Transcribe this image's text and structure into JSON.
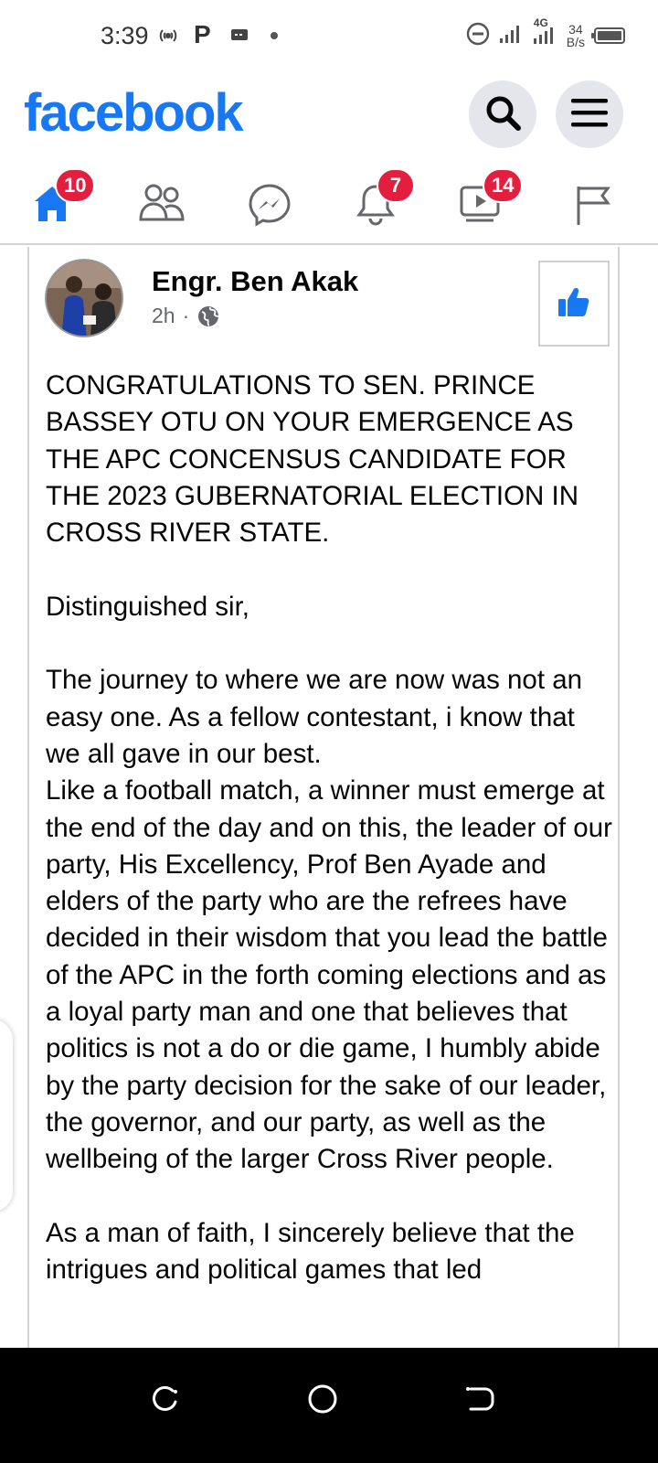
{
  "status_bar": {
    "time": "3:39",
    "icons": [
      "hotspot-icon",
      "p-icon",
      "message-icon",
      "dot-icon",
      "do-not-disturb-icon",
      "signal-icon",
      "signal-4g-icon",
      "battery-icon"
    ],
    "network": "4G",
    "speed_value": "34",
    "speed_unit": "B/s"
  },
  "header": {
    "logo": "facebook",
    "brand_color": "#1877f2",
    "search_icon": "search-icon",
    "menu_icon": "menu-icon"
  },
  "nav": {
    "tabs": [
      {
        "name": "home",
        "icon": "home-icon",
        "badge": "10",
        "active": true
      },
      {
        "name": "friends",
        "icon": "friends-icon",
        "badge": ""
      },
      {
        "name": "messenger",
        "icon": "messenger-icon",
        "badge": ""
      },
      {
        "name": "notifications",
        "icon": "bell-icon",
        "badge": "7"
      },
      {
        "name": "watch",
        "icon": "video-icon",
        "badge": "14"
      },
      {
        "name": "pages",
        "icon": "flag-icon",
        "badge": ""
      }
    ],
    "badge_color": "#e41e3f"
  },
  "post": {
    "author": "Engr. Ben Akak",
    "time": "2h",
    "separator": "·",
    "privacy_icon": "globe-icon",
    "like_icon": "thumbs-up-icon",
    "paragraphs": [
      "CONGRATULATIONS TO SEN. PRINCE BASSEY OTU ON YOUR EMERGENCE AS THE APC CONCENSUS CANDIDATE FOR THE 2023 GUBERNATORIAL ELECTION IN CROSS RIVER STATE.",
      "Distinguished sir,",
      "The journey to where we are now was not an easy one. As a fellow contestant, i know that we all gave in our best.\nLike a football match, a winner must emerge at the end of the day and on this, the leader of our party, His Excellency, Prof Ben Ayade and elders of the party who are the refrees have decided in their wisdom that you lead the battle of the APC in the forth coming elections and as a loyal party man and one that believes that politics is not a do or die game, I humbly abide by the party decision for the sake of our leader, the governor, and our party, as well as the wellbeing of the larger Cross River people.",
      "As a man of faith, I sincerely believe that the intrigues and political games that led"
    ]
  },
  "android_nav": {
    "buttons": [
      "recents-icon",
      "home-circle-icon",
      "back-icon"
    ]
  }
}
